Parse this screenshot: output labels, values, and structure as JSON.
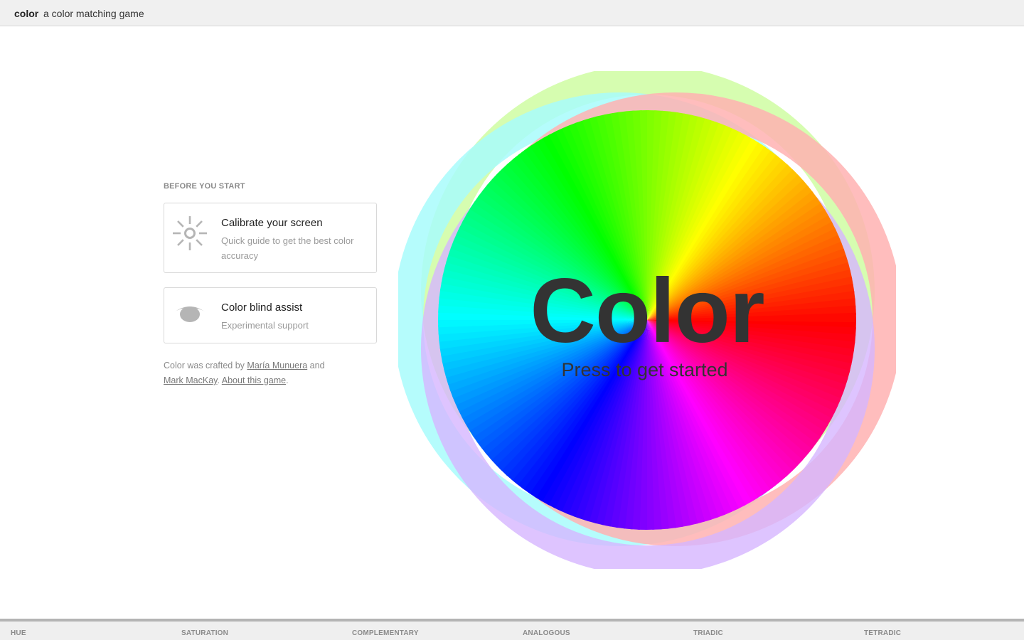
{
  "header": {
    "brand": "color",
    "tagline": "a color matching game"
  },
  "sidebar": {
    "heading": "BEFORE YOU START",
    "cards": [
      {
        "title": "Calibrate your screen",
        "description": "Quick guide to get the best color accuracy",
        "icon": "sun-icon"
      },
      {
        "title": "Color blind assist",
        "description": "Experimental support",
        "icon": "eye-icon"
      }
    ],
    "credits": {
      "prefix": "Color was crafted by",
      "author1": "María Munuera",
      "and": "and",
      "author2": "Mark MacKay",
      "separator": ".",
      "about": "About this game",
      "suffix": "."
    }
  },
  "hero": {
    "title": "Color",
    "subtitle": "Press to get started"
  },
  "footer": {
    "tabs": [
      "HUE",
      "SATURATION",
      "COMPLEMENTARY",
      "ANALOGOUS",
      "TRIADIC",
      "TETRADIC"
    ]
  },
  "colors": {
    "icon_gray": "#b5b5b5",
    "title_text": "#333333",
    "halo_green": "#d6fdb0",
    "halo_cyan": "#a8fbfb",
    "halo_red": "#ffb1b1",
    "halo_purple": "#d6b5ff"
  }
}
